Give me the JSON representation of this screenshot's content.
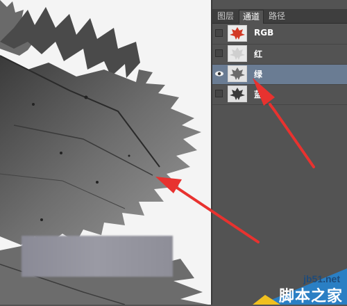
{
  "panel": {
    "tabs": [
      {
        "label": "图层",
        "active": false
      },
      {
        "label": "通道",
        "active": true
      },
      {
        "label": "路径",
        "active": false
      }
    ],
    "channels": [
      {
        "label": "RGB",
        "visible": false,
        "selected": false,
        "thumb": "color-leaf"
      },
      {
        "label": "红",
        "visible": false,
        "selected": false,
        "thumb": "pale-leaf"
      },
      {
        "label": "绿",
        "visible": true,
        "selected": true,
        "thumb": "gray-leaf"
      },
      {
        "label": "蓝",
        "visible": false,
        "selected": false,
        "thumb": "dark-leaf"
      }
    ]
  },
  "watermark": {
    "site": "jb51.net",
    "name": "脚本之家"
  },
  "colors": {
    "panel_bg": "#535353",
    "tab_bar": "#3e3e3e",
    "selected_row": "#6a7c93",
    "arrow": "#e8322f"
  }
}
